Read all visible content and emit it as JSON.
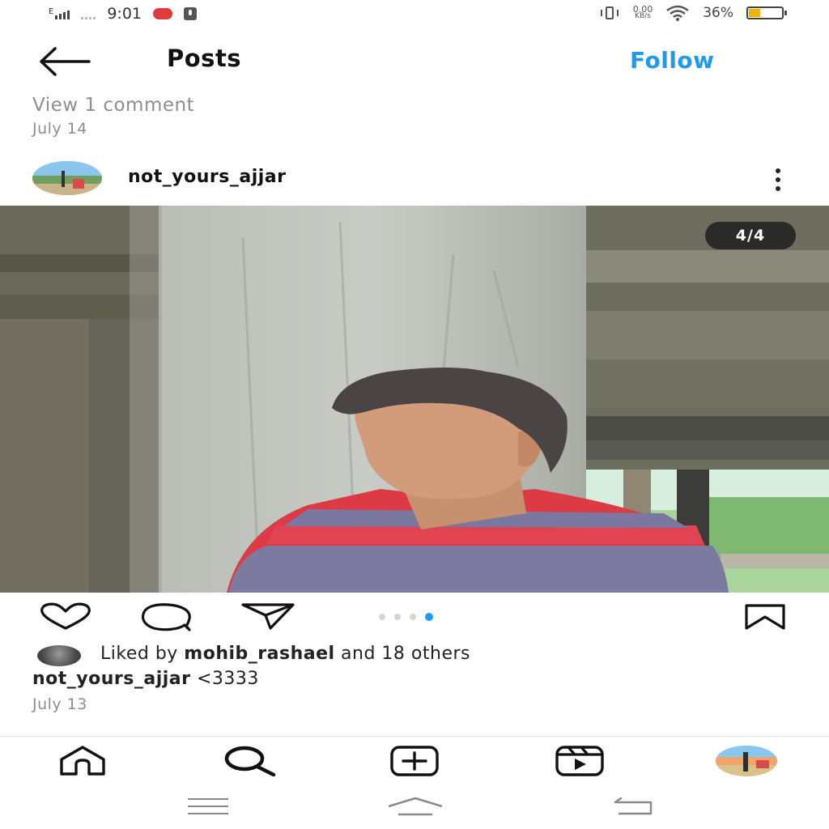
{
  "status_bar": {
    "network_type": "E",
    "time": "9:01",
    "net_speed_value": "0.00",
    "net_speed_unit": "KB/s",
    "battery_percent": "36%",
    "battery_level": 0.36
  },
  "header": {
    "title": "Posts",
    "follow_label": "Follow"
  },
  "previous_post": {
    "view_comments": "View 1 comment",
    "date": "July 14"
  },
  "post": {
    "username": "not_yours_ajjar",
    "media_counter": "4/4",
    "carousel_total": 4,
    "carousel_active_index": 3,
    "liked_prefix": "Liked by ",
    "liked_user": "mohib_rashael",
    "liked_suffix": " and 18 others",
    "caption_user": "not_yours_ajjar",
    "caption_text": " <3333",
    "date": "July 13"
  },
  "colors": {
    "accent": "#1e9bf0",
    "muted_text": "#8e8e8e",
    "battery": "#f5b400"
  },
  "icons": {
    "back": "arrow-left-icon",
    "more": "more-vertical-icon",
    "like": "heart-icon",
    "comment": "comment-icon",
    "share": "paper-plane-icon",
    "save": "bookmark-icon",
    "nav": [
      "home-icon",
      "search-icon",
      "add-post-icon",
      "reels-icon",
      "profile-avatar"
    ]
  }
}
